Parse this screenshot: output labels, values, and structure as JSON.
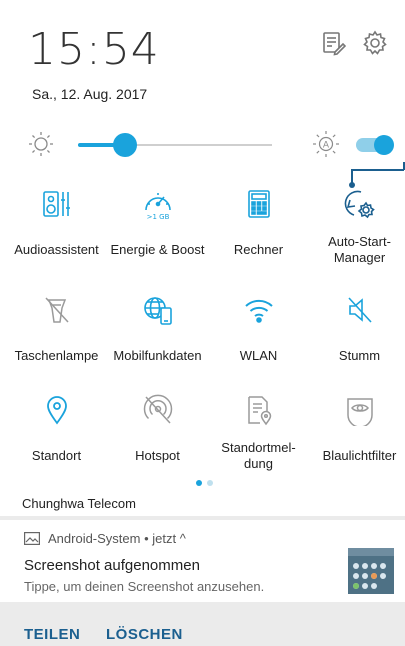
{
  "status": {
    "time": "15:54",
    "date": "Sa., 12. Aug. 2017"
  },
  "header_icons": [
    "edit-tiles-icon",
    "settings-gear-icon"
  ],
  "brightness": {
    "level": 0.24,
    "auto_enabled": true
  },
  "tiles": [
    {
      "label": "Audioassistent",
      "icon": "audio-equalizer-icon",
      "active": true
    },
    {
      "label": "Energie & Boost",
      "icon": "speedometer-boost-icon",
      "active": true,
      "badge": ">1 GB"
    },
    {
      "label": "Rechner",
      "icon": "calculator-icon",
      "active": true
    },
    {
      "label": "Auto-Start-\nManager",
      "icon": "auto-start-gear-icon",
      "active": true
    },
    {
      "label": "Taschenlampe",
      "icon": "flashlight-off-icon",
      "active": false
    },
    {
      "label": "Mobilfunkdaten",
      "icon": "globe-phone-icon",
      "active": true
    },
    {
      "label": "WLAN",
      "icon": "wifi-icon",
      "active": true
    },
    {
      "label": "Stumm",
      "icon": "speaker-mute-icon",
      "active": true
    },
    {
      "label": "Standort",
      "icon": "location-pin-icon",
      "active": true
    },
    {
      "label": "Hotspot",
      "icon": "hotspot-off-icon",
      "active": false
    },
    {
      "label": "Standortmel-\ndung",
      "icon": "location-report-icon",
      "active": false
    },
    {
      "label": "Blaulichtfilter",
      "icon": "eye-filter-icon",
      "active": false
    }
  ],
  "pager": {
    "pages": 2,
    "current": 0
  },
  "carrier": "Chunghwa Telecom",
  "notification": {
    "app": "Android-System",
    "time": "jetzt",
    "header": "Android-System • jetzt ^",
    "title": "Screenshot aufgenommen",
    "body": "Tippe, um deinen Screenshot anzusehen.",
    "actions": {
      "share": "TEILEN",
      "delete": "LÖSCHEN"
    }
  },
  "colors": {
    "accent": "#1aa3dc",
    "inactive": "#9a9a9a",
    "action": "#1b5f8f"
  }
}
